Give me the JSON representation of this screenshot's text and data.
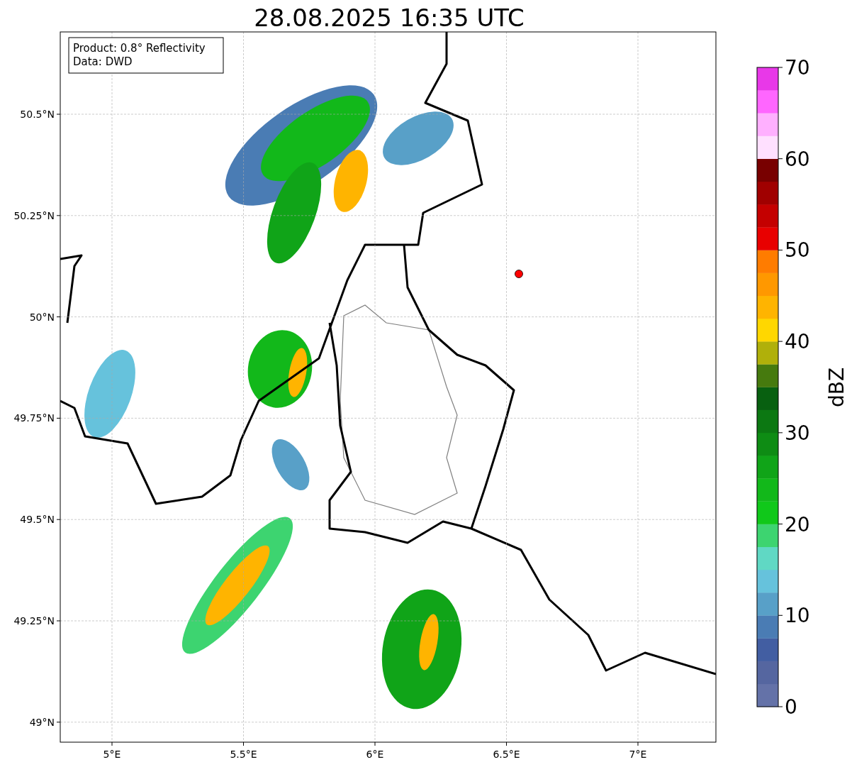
{
  "title": "28.08.2025 16:35 UTC",
  "info_box": [
    "Product: 0.8° Reflectivity",
    "Data: DWD"
  ],
  "map": {
    "lat_labels": [
      "50.5°N",
      "50.25°N",
      "50°N",
      "49.75°N",
      "49.5°N",
      "49.25°N",
      "49°N"
    ],
    "lon_labels": [
      "5°E",
      "5.5°E",
      "6°E",
      "6.5°E",
      "7°E"
    ]
  },
  "colorbar": {
    "label": "dBZ",
    "ticks": [
      "70",
      "60",
      "50",
      "40",
      "30",
      "20",
      "10",
      "0"
    ],
    "segments": [
      {
        "color": "#6472a8"
      },
      {
        "color": "#5566a0"
      },
      {
        "color": "#425ea2"
      },
      {
        "color": "#4a7cb4"
      },
      {
        "color": "#58a0c8"
      },
      {
        "color": "#66c2dc"
      },
      {
        "color": "#60d8c4"
      },
      {
        "color": "#3dd470"
      },
      {
        "color": "#10c81a"
      },
      {
        "color": "#12b81a"
      },
      {
        "color": "#10a418"
      },
      {
        "color": "#0e8c14"
      },
      {
        "color": "#0c7812"
      },
      {
        "color": "#086010"
      },
      {
        "color": "#467a0e"
      },
      {
        "color": "#b0b00a"
      },
      {
        "color": "#ffd700"
      },
      {
        "color": "#ffb400"
      },
      {
        "color": "#ff9800"
      },
      {
        "color": "#ff7c00"
      },
      {
        "color": "#e80000"
      },
      {
        "color": "#c40000"
      },
      {
        "color": "#a00000"
      },
      {
        "color": "#780000"
      },
      {
        "color": "#ffe0ff"
      },
      {
        "color": "#ffb0ff"
      },
      {
        "color": "#ff66ff"
      },
      {
        "color": "#e838e8"
      }
    ]
  }
}
